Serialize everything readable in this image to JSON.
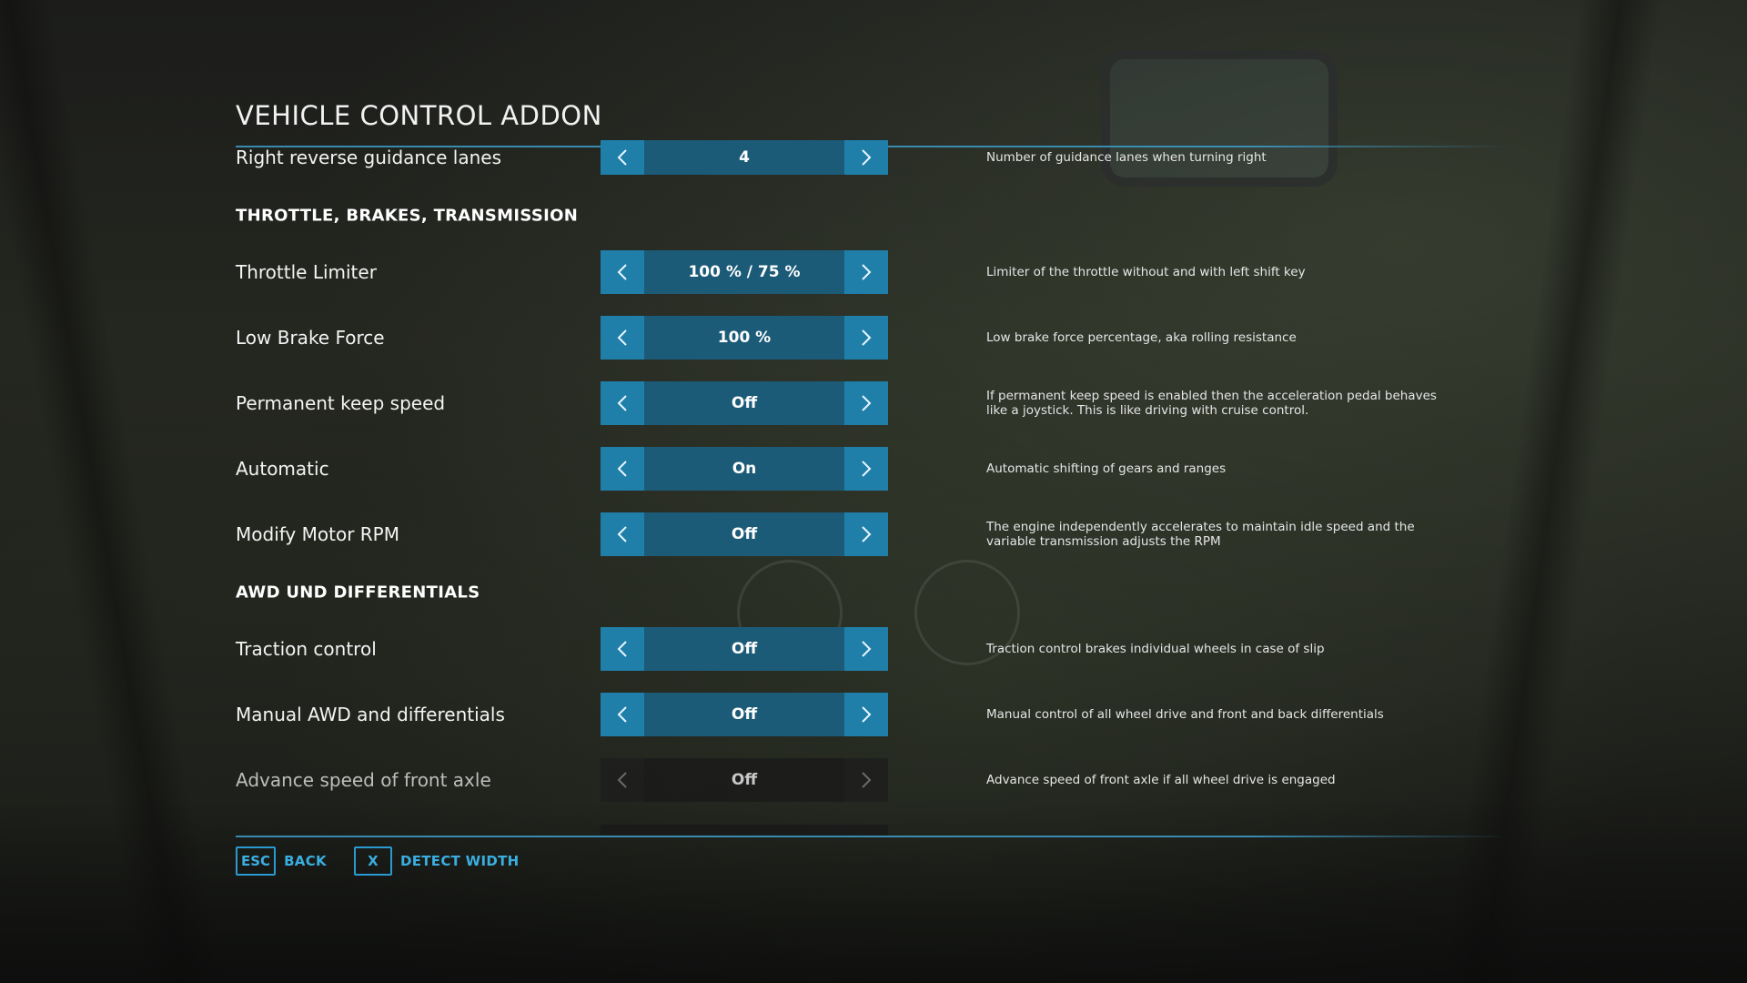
{
  "page": {
    "title": "VEHICLE CONTROL ADDON"
  },
  "settings": [
    {
      "kind": "row",
      "label": "Right reverse guidance lanes",
      "value": "4",
      "description": "Number of guidance lanes when turning right"
    },
    {
      "kind": "section",
      "label": "THROTTLE, BRAKES, TRANSMISSION"
    },
    {
      "kind": "row",
      "label": "Throttle Limiter",
      "value": "100 % /  75 %",
      "description": "Limiter of the throttle without and with left shift key"
    },
    {
      "kind": "row",
      "label": "Low Brake Force",
      "value": "100 %",
      "description": "Low brake force percentage, aka rolling resistance"
    },
    {
      "kind": "row",
      "label": "Permanent keep speed",
      "value": "Off",
      "description": "If permanent keep speed is enabled then the acceleration pedal behaves like a joystick. This is like driving with cruise control."
    },
    {
      "kind": "row",
      "label": "Automatic",
      "value": "On",
      "description": "Automatic shifting of gears and ranges"
    },
    {
      "kind": "row",
      "label": "Modify Motor RPM",
      "value": "Off",
      "description": "The engine independently accelerates to maintain idle speed and the variable transmission adjusts the RPM"
    },
    {
      "kind": "section",
      "label": "AWD UND DIFFERENTIALS"
    },
    {
      "kind": "row",
      "label": "Traction control",
      "value": "Off",
      "description": "Traction control brakes individual wheels in case of slip"
    },
    {
      "kind": "row",
      "label": "Manual AWD and differentials",
      "value": "Off",
      "description": "Manual control of all wheel drive and front and back differentials"
    },
    {
      "kind": "row",
      "label": "Advance speed of front axle",
      "value": "Off",
      "description": "Advance speed of front axle if all wheel drive is engaged",
      "disabled": true
    }
  ],
  "icons": {
    "prev": "chevron-left-icon",
    "next": "chevron-right-icon"
  },
  "footer": {
    "back_key": "ESC",
    "back_label": "BACK",
    "detect_key": "X",
    "detect_label": "DETECT WIDTH"
  },
  "colors": {
    "accent": "#1f7fa9",
    "value_bg": "#1c5b78",
    "footer_accent": "#3aaee0"
  }
}
